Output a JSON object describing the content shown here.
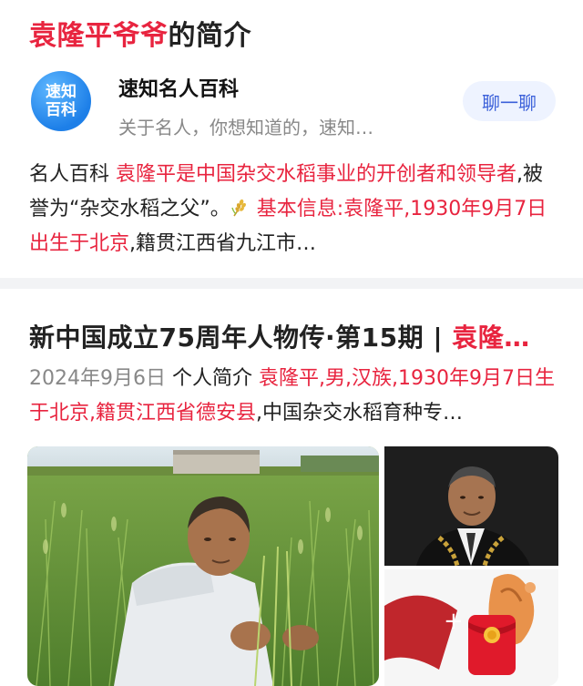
{
  "card1": {
    "title_highlight": "袁隆平爷爷",
    "title_rest": "的简介",
    "source": {
      "logo_text": "速知\n百科",
      "name": "速知名人百科",
      "description": "关于名人，你想知道的，速知…",
      "chat_button": "聊一聊"
    },
    "summary": {
      "prefix": "名人百科 ",
      "highlight1": "袁隆平是中国杂交水稻事业的开创者和领导者",
      "mid": ",被誉为“杂交水稻之父”。",
      "highlight2": "基本信息:袁隆平,1930年9月7日出生于北京",
      "tail": ",籍贯江西省九江市…"
    }
  },
  "card2": {
    "title_normal": "新中国成立75周年人物传·第15期 | ",
    "title_highlight": "袁隆…",
    "date": "2024年9月6日",
    "label": " 个人简介 ",
    "highlight": "袁隆平,男,汉族,1930年9月7日生于北京,籍贯江西省德安县",
    "tail": ",中国杂交水稻育种专…"
  },
  "colors": {
    "accent_red": "#e8243f",
    "chat_button_bg": "#eef3ff",
    "chat_button_text": "#3a5fd9",
    "logo_blue": "#1d7fe8"
  }
}
